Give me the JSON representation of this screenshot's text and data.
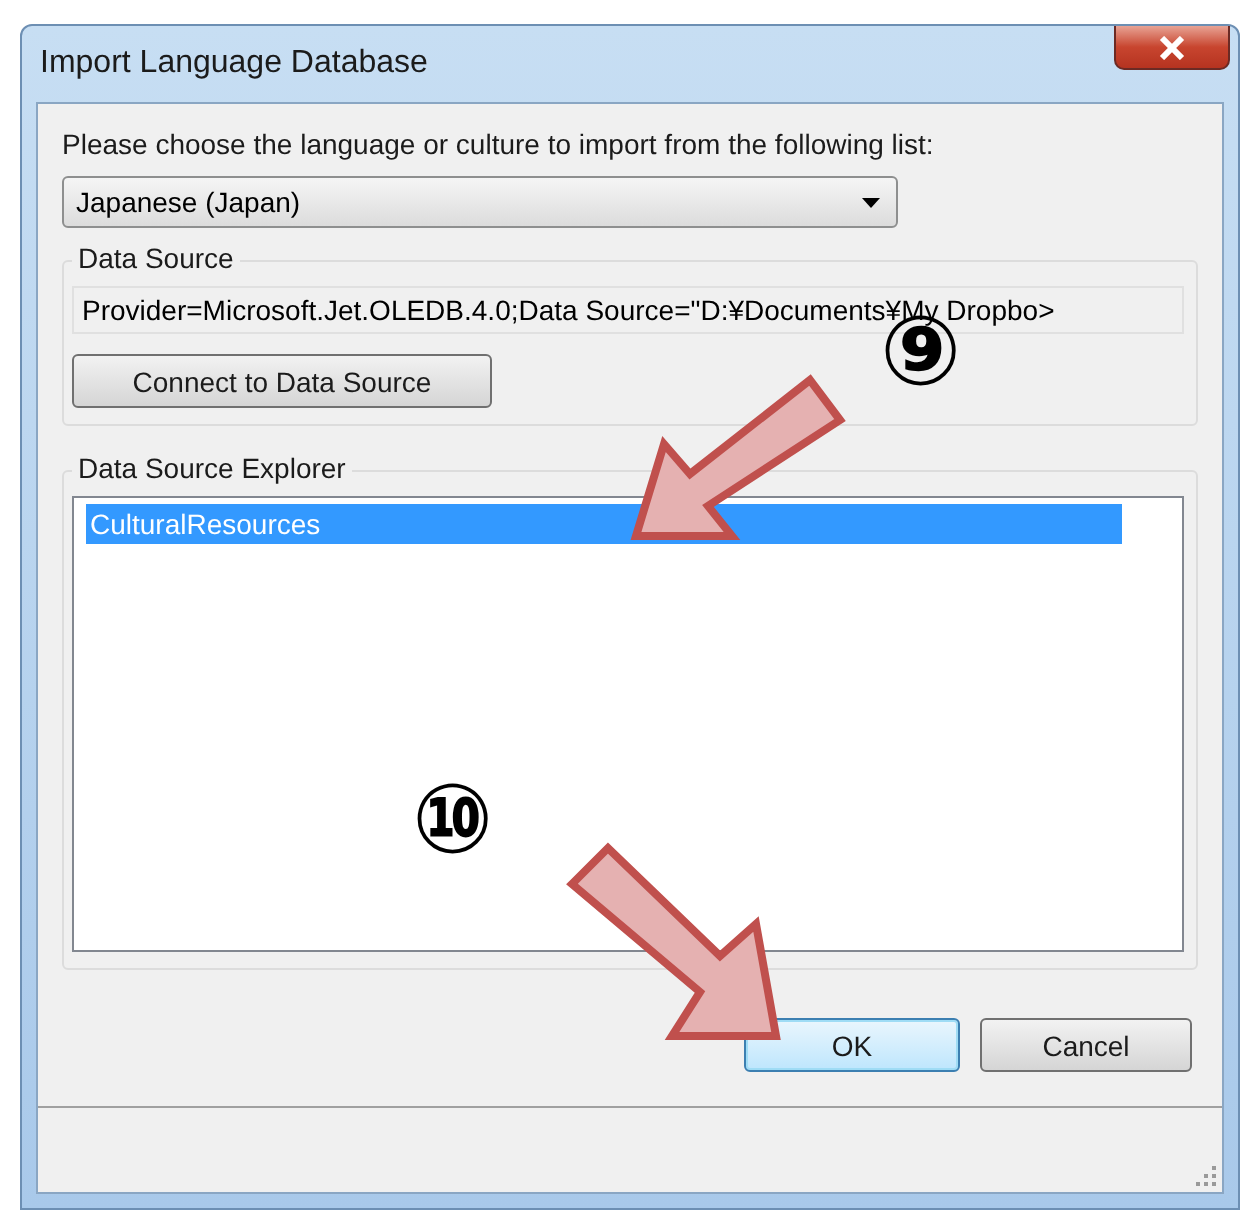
{
  "window": {
    "title": "Import Language Database"
  },
  "prompt": "Please choose the language or culture to import from the following list:",
  "language_select": {
    "value": "Japanese (Japan)"
  },
  "data_source": {
    "label": "Data Source",
    "connection_string": "Provider=Microsoft.Jet.OLEDB.4.0;Data Source=\"D:¥Documents¥My Dropbo>",
    "button": "Connect to Data Source"
  },
  "explorer": {
    "label": "Data Source Explorer",
    "items": [
      {
        "label": "CulturalResources",
        "selected": true
      }
    ]
  },
  "buttons": [
    {
      "label": "OK",
      "default": true
    },
    {
      "label": "Cancel",
      "default": false
    }
  ],
  "annotations": [
    {
      "label": "⑨"
    },
    {
      "label": "⑩"
    }
  ]
}
